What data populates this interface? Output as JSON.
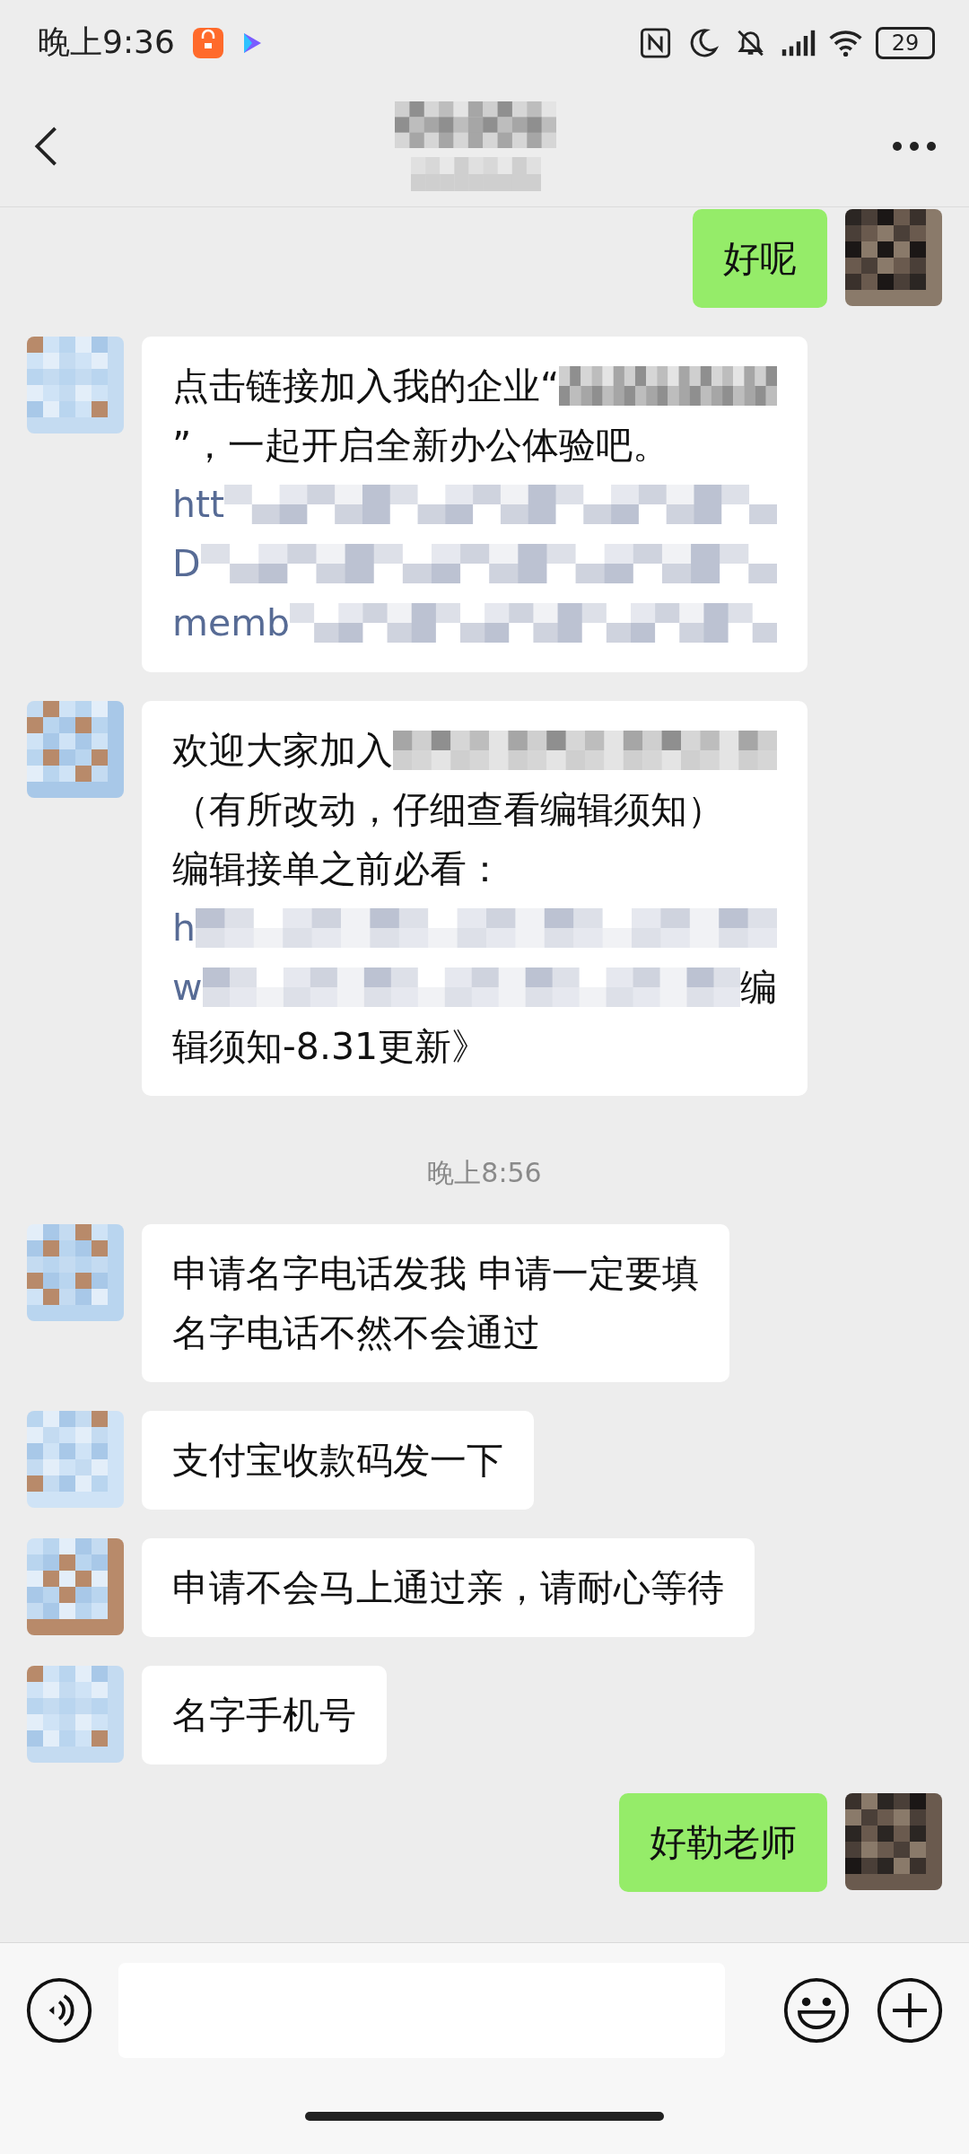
{
  "status_bar": {
    "time": "晚上9:36",
    "battery": "29"
  },
  "messages": [
    {
      "kind": "message",
      "sent": true,
      "lines": [
        [
          {
            "kind": "text",
            "text": "好呢"
          }
        ]
      ]
    },
    {
      "kind": "message",
      "sent": false,
      "lines": [
        [
          {
            "kind": "text",
            "text": "点击链接加入我的企业“"
          },
          {
            "kind": "blur"
          }
        ],
        [
          {
            "kind": "text",
            "text": "”，一起开启全新办公体验吧。"
          }
        ],
        [
          {
            "kind": "link",
            "text": "htt"
          },
          {
            "kind": "blur"
          }
        ],
        [
          {
            "kind": "link",
            "text": "D"
          },
          {
            "kind": "blur"
          }
        ],
        [
          {
            "kind": "link",
            "text": "memb"
          },
          {
            "kind": "blur"
          }
        ]
      ]
    },
    {
      "kind": "message",
      "sent": false,
      "lines": [
        [
          {
            "kind": "text",
            "text": "欢迎大家加入"
          },
          {
            "kind": "blur"
          }
        ],
        [
          {
            "kind": "text",
            "text": "（有所改动，仔细查看编辑须知）"
          }
        ],
        [
          {
            "kind": "text",
            "text": "编辑接单之前必看："
          }
        ],
        [
          {
            "kind": "link",
            "text": "h"
          },
          {
            "kind": "blur"
          }
        ],
        [
          {
            "kind": "link",
            "text": "w"
          },
          {
            "kind": "blur"
          },
          {
            "kind": "text",
            "text": "编"
          }
        ],
        [
          {
            "kind": "text",
            "text": "辑须知-8.31更新》"
          }
        ]
      ]
    },
    {
      "kind": "time",
      "text": "晚上8:56"
    },
    {
      "kind": "message",
      "sent": false,
      "lines": [
        [
          {
            "kind": "text",
            "text": "申请名字电话发我 申请一定要填"
          }
        ],
        [
          {
            "kind": "text",
            "text": "名字电话不然不会通过"
          }
        ]
      ]
    },
    {
      "kind": "message",
      "sent": false,
      "lines": [
        [
          {
            "kind": "text",
            "text": "支付宝收款码发一下"
          }
        ]
      ]
    },
    {
      "kind": "message",
      "sent": false,
      "lines": [
        [
          {
            "kind": "text",
            "text": "申请不会马上通过亲，请耐心等待"
          }
        ]
      ]
    },
    {
      "kind": "message",
      "sent": false,
      "lines": [
        [
          {
            "kind": "text",
            "text": "名字手机号"
          }
        ]
      ]
    },
    {
      "kind": "message",
      "sent": true,
      "lines": [
        [
          {
            "kind": "text",
            "text": "好勒老师"
          }
        ]
      ]
    }
  ]
}
